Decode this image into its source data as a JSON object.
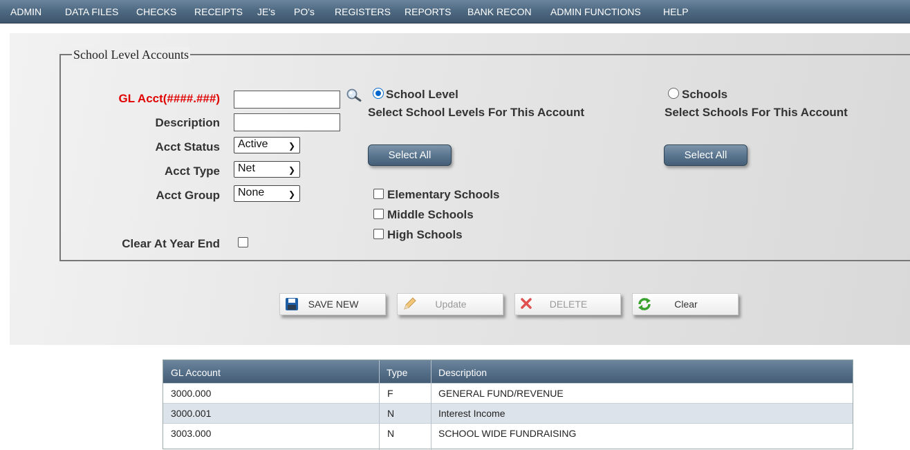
{
  "nav": {
    "items": [
      "ADMIN",
      "DATA FILES",
      "CHECKS",
      "RECEIPTS",
      "JE's",
      "PO's",
      "REGISTERS",
      "REPORTS",
      "BANK RECON",
      "ADMIN FUNCTIONS",
      "HELP"
    ]
  },
  "form": {
    "legend": "School Level Accounts",
    "gl_acct_label": "GL Acct(####.###)",
    "gl_acct_value": "",
    "description_label": "Description",
    "description_value": "",
    "acct_status_label": "Acct Status",
    "acct_status_value": "Active",
    "acct_type_label": "Acct Type",
    "acct_type_value": "Net",
    "acct_group_label": "Acct Group",
    "acct_group_value": "None",
    "clear_year_end_label": "Clear At Year End",
    "clear_year_end_checked": false
  },
  "school_level": {
    "radio_label": "School Level",
    "selected": true,
    "instructions": "Select School Levels For This Account",
    "select_all": "Select All",
    "levels": [
      "Elementary Schools",
      "Middle Schools",
      "High Schools"
    ]
  },
  "schools": {
    "radio_label": "Schools",
    "selected": false,
    "instructions": "Select Schools For This Account",
    "select_all": "Select All"
  },
  "actions": {
    "save_new": "SAVE NEW",
    "update": "Update",
    "delete": "DELETE",
    "clear": "Clear"
  },
  "grid": {
    "headers": [
      "GL Account",
      "Type",
      "Description"
    ],
    "rows": [
      [
        "3000.000",
        "F",
        "GENERAL FUND/REVENUE"
      ],
      [
        "3000.001",
        "N",
        "Interest Income"
      ],
      [
        "3003.000",
        "N",
        "SCHOOL WIDE FUNDRAISING"
      ]
    ]
  },
  "colors": {
    "nav_bg": "#4f6a83",
    "required_label": "#e00000",
    "radio_accent": "#0066cc"
  }
}
